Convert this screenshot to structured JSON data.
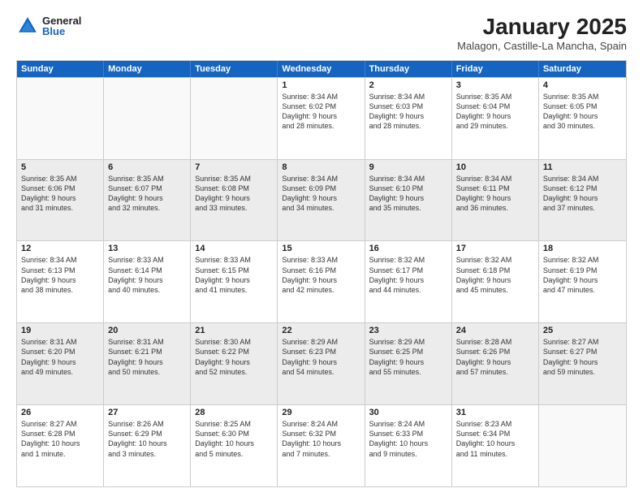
{
  "logo": {
    "general": "General",
    "blue": "Blue"
  },
  "title": "January 2025",
  "subtitle": "Malagon, Castille-La Mancha, Spain",
  "days": [
    "Sunday",
    "Monday",
    "Tuesday",
    "Wednesday",
    "Thursday",
    "Friday",
    "Saturday"
  ],
  "rows": [
    [
      {
        "day": "",
        "lines": []
      },
      {
        "day": "",
        "lines": []
      },
      {
        "day": "",
        "lines": []
      },
      {
        "day": "1",
        "lines": [
          "Sunrise: 8:34 AM",
          "Sunset: 6:02 PM",
          "Daylight: 9 hours",
          "and 28 minutes."
        ]
      },
      {
        "day": "2",
        "lines": [
          "Sunrise: 8:34 AM",
          "Sunset: 6:03 PM",
          "Daylight: 9 hours",
          "and 28 minutes."
        ]
      },
      {
        "day": "3",
        "lines": [
          "Sunrise: 8:35 AM",
          "Sunset: 6:04 PM",
          "Daylight: 9 hours",
          "and 29 minutes."
        ]
      },
      {
        "day": "4",
        "lines": [
          "Sunrise: 8:35 AM",
          "Sunset: 6:05 PM",
          "Daylight: 9 hours",
          "and 30 minutes."
        ]
      }
    ],
    [
      {
        "day": "5",
        "lines": [
          "Sunrise: 8:35 AM",
          "Sunset: 6:06 PM",
          "Daylight: 9 hours",
          "and 31 minutes."
        ]
      },
      {
        "day": "6",
        "lines": [
          "Sunrise: 8:35 AM",
          "Sunset: 6:07 PM",
          "Daylight: 9 hours",
          "and 32 minutes."
        ]
      },
      {
        "day": "7",
        "lines": [
          "Sunrise: 8:35 AM",
          "Sunset: 6:08 PM",
          "Daylight: 9 hours",
          "and 33 minutes."
        ]
      },
      {
        "day": "8",
        "lines": [
          "Sunrise: 8:34 AM",
          "Sunset: 6:09 PM",
          "Daylight: 9 hours",
          "and 34 minutes."
        ]
      },
      {
        "day": "9",
        "lines": [
          "Sunrise: 8:34 AM",
          "Sunset: 6:10 PM",
          "Daylight: 9 hours",
          "and 35 minutes."
        ]
      },
      {
        "day": "10",
        "lines": [
          "Sunrise: 8:34 AM",
          "Sunset: 6:11 PM",
          "Daylight: 9 hours",
          "and 36 minutes."
        ]
      },
      {
        "day": "11",
        "lines": [
          "Sunrise: 8:34 AM",
          "Sunset: 6:12 PM",
          "Daylight: 9 hours",
          "and 37 minutes."
        ]
      }
    ],
    [
      {
        "day": "12",
        "lines": [
          "Sunrise: 8:34 AM",
          "Sunset: 6:13 PM",
          "Daylight: 9 hours",
          "and 38 minutes."
        ]
      },
      {
        "day": "13",
        "lines": [
          "Sunrise: 8:33 AM",
          "Sunset: 6:14 PM",
          "Daylight: 9 hours",
          "and 40 minutes."
        ]
      },
      {
        "day": "14",
        "lines": [
          "Sunrise: 8:33 AM",
          "Sunset: 6:15 PM",
          "Daylight: 9 hours",
          "and 41 minutes."
        ]
      },
      {
        "day": "15",
        "lines": [
          "Sunrise: 8:33 AM",
          "Sunset: 6:16 PM",
          "Daylight: 9 hours",
          "and 42 minutes."
        ]
      },
      {
        "day": "16",
        "lines": [
          "Sunrise: 8:32 AM",
          "Sunset: 6:17 PM",
          "Daylight: 9 hours",
          "and 44 minutes."
        ]
      },
      {
        "day": "17",
        "lines": [
          "Sunrise: 8:32 AM",
          "Sunset: 6:18 PM",
          "Daylight: 9 hours",
          "and 45 minutes."
        ]
      },
      {
        "day": "18",
        "lines": [
          "Sunrise: 8:32 AM",
          "Sunset: 6:19 PM",
          "Daylight: 9 hours",
          "and 47 minutes."
        ]
      }
    ],
    [
      {
        "day": "19",
        "lines": [
          "Sunrise: 8:31 AM",
          "Sunset: 6:20 PM",
          "Daylight: 9 hours",
          "and 49 minutes."
        ]
      },
      {
        "day": "20",
        "lines": [
          "Sunrise: 8:31 AM",
          "Sunset: 6:21 PM",
          "Daylight: 9 hours",
          "and 50 minutes."
        ]
      },
      {
        "day": "21",
        "lines": [
          "Sunrise: 8:30 AM",
          "Sunset: 6:22 PM",
          "Daylight: 9 hours",
          "and 52 minutes."
        ]
      },
      {
        "day": "22",
        "lines": [
          "Sunrise: 8:29 AM",
          "Sunset: 6:23 PM",
          "Daylight: 9 hours",
          "and 54 minutes."
        ]
      },
      {
        "day": "23",
        "lines": [
          "Sunrise: 8:29 AM",
          "Sunset: 6:25 PM",
          "Daylight: 9 hours",
          "and 55 minutes."
        ]
      },
      {
        "day": "24",
        "lines": [
          "Sunrise: 8:28 AM",
          "Sunset: 6:26 PM",
          "Daylight: 9 hours",
          "and 57 minutes."
        ]
      },
      {
        "day": "25",
        "lines": [
          "Sunrise: 8:27 AM",
          "Sunset: 6:27 PM",
          "Daylight: 9 hours",
          "and 59 minutes."
        ]
      }
    ],
    [
      {
        "day": "26",
        "lines": [
          "Sunrise: 8:27 AM",
          "Sunset: 6:28 PM",
          "Daylight: 10 hours",
          "and 1 minute."
        ]
      },
      {
        "day": "27",
        "lines": [
          "Sunrise: 8:26 AM",
          "Sunset: 6:29 PM",
          "Daylight: 10 hours",
          "and 3 minutes."
        ]
      },
      {
        "day": "28",
        "lines": [
          "Sunrise: 8:25 AM",
          "Sunset: 6:30 PM",
          "Daylight: 10 hours",
          "and 5 minutes."
        ]
      },
      {
        "day": "29",
        "lines": [
          "Sunrise: 8:24 AM",
          "Sunset: 6:32 PM",
          "Daylight: 10 hours",
          "and 7 minutes."
        ]
      },
      {
        "day": "30",
        "lines": [
          "Sunrise: 8:24 AM",
          "Sunset: 6:33 PM",
          "Daylight: 10 hours",
          "and 9 minutes."
        ]
      },
      {
        "day": "31",
        "lines": [
          "Sunrise: 8:23 AM",
          "Sunset: 6:34 PM",
          "Daylight: 10 hours",
          "and 11 minutes."
        ]
      },
      {
        "day": "",
        "lines": []
      }
    ]
  ],
  "shaded_rows": [
    1,
    3
  ]
}
